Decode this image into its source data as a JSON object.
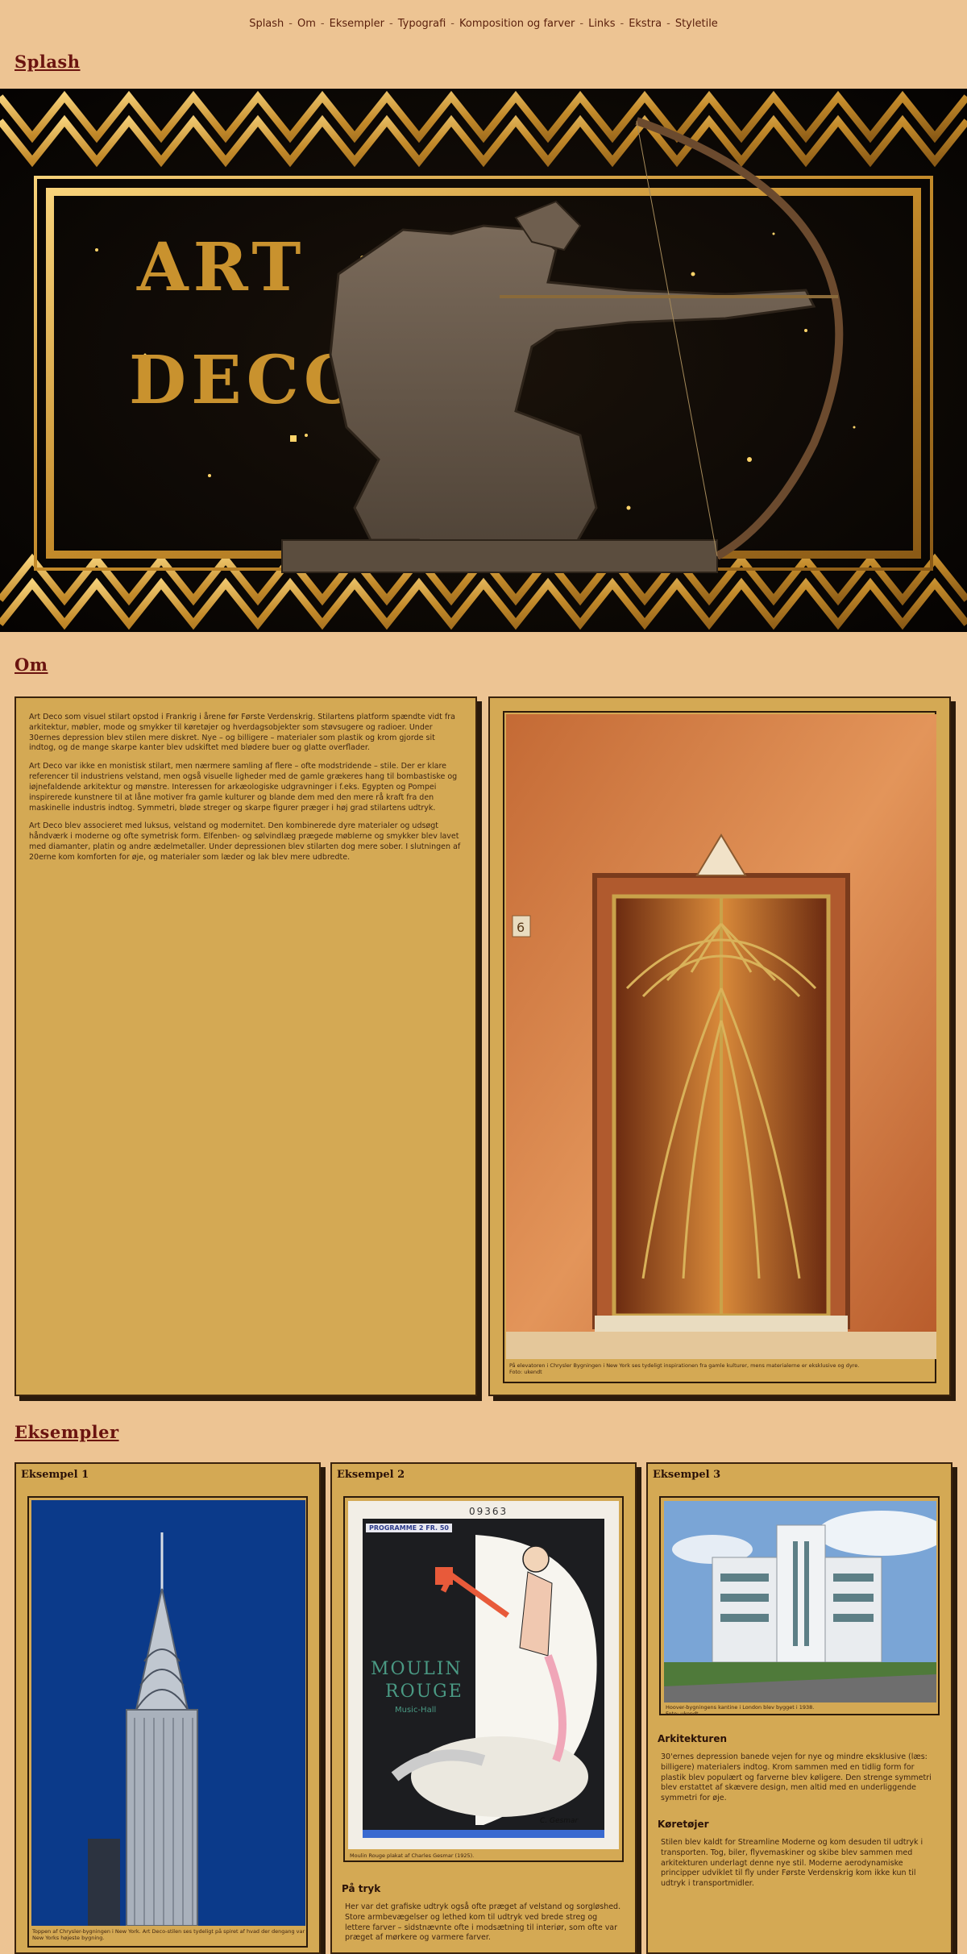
{
  "nav": {
    "items": [
      "Splash",
      "Om",
      "Eksempler",
      "Typografi",
      "Komposition og farver",
      "Links",
      "Ekstra",
      "Styletile"
    ],
    "separator": "-"
  },
  "sections": {
    "splash": "Splash",
    "om": "Om",
    "eksempler": "Eksempler"
  },
  "hero": {
    "line1": "ART",
    "line2": "DECO"
  },
  "om": {
    "paragraphs": [
      "Art Deco som visuel stilart opstod i Frankrig i årene før Første Verdenskrig. Stilartens platform spændte vidt fra arkitektur, møbler, mode og smykker til køretøjer og hverdagsobjekter som støvsugere og radioer. Under 30ernes depression blev stilen mere diskret. Nye – og billigere – materialer som plastik og krom gjorde sit indtog, og de mange skarpe kanter blev udskiftet med blødere buer og glatte overflader.",
      "Art Deco var ikke en monistisk stilart, men nærmere samling af flere – ofte modstridende – stile. Der er klare referencer til industriens velstand, men også visuelle ligheder med de gamle grækeres hang til bombastiske og iøjnefaldende arkitektur og mønstre. Interessen for arkæologiske udgravninger i f.eks. Egypten og Pompei inspirerede kunstnere til at låne motiver fra gamle kulturer og blande dem med den mere rå kraft fra den maskinelle industris indtog. Symmetri, bløde streger og skarpe figurer præger i høj grad stilartens udtryk.",
      "Art Deco blev associeret med luksus, velstand og modernitet. Den kombinerede dyre materialer og udsøgt håndværk i moderne og ofte symetrisk form. Elfenben- og sølvindlæg prægede møblerne og smykker blev lavet med diamanter, platin og andre ædelmetaller. Under depressionen blev stilarten dog mere sober. I slutningen af 20erne kom komforten for øje, og materialer som læder og lak blev mere udbredte."
    ],
    "image_caption": "På elevatoren i Chrysler Bygningen i New York ses tydeligt inspirationen fra gamle kulturer, mens materialerne er eksklusive og dyre.",
    "image_credit": "Foto: ukendt",
    "elevator_number": "6"
  },
  "examples": [
    {
      "title": "Eksempel 1",
      "caption": "Toppen af Chrysler-bygningen i New York. Art Deco-stilen ses tydeligt på spiret af hvad der dengang var New Yorks højeste bygning."
    },
    {
      "title": "Eksempel 2",
      "caption": "Moulin Rouge plakat af Charles Gesmar (1925).",
      "poster": {
        "number": "09363",
        "programme": "PROGRAMME 2 FR. 50",
        "title1": "MOULIN",
        "title2": "ROUGE",
        "subtitle": "Music-Hall",
        "signature": "C. Gesmar"
      },
      "heading": "På tryk",
      "text": "Her var det grafiske udtryk også ofte præget af velstand og sorgløshed. Store armbevægelser og lethed kom til udtryk ved brede streg og lettere farver – sidstnævnte ofte i modsætning til interiør, som ofte var præget af mørkere og varmere farver."
    },
    {
      "title": "Eksempel 3",
      "caption": "Hoover-bygningens kantine i London blev bygget i 1938.",
      "credit": "Foto: ukendt",
      "headings": [
        "Arkitekturen",
        "Køretøjer"
      ],
      "texts": [
        "30'ernes depression banede vejen for nye og mindre eksklusive (læs: billigere) materialers indtog. Krom sammen med en tidlig form for plastik blev populært og farverne blev køligere. Den strenge symmetri blev erstattet af skævere design, men altid med en underliggende symmetri for øje.",
        "Stilen blev kaldt for Streamline Moderne og kom desuden til udtryk i transporten. Tog, biler, flyvemaskiner og skibe blev sammen med arkitekturen underlagt denne nye stil. Moderne aerodynamiske principper udviklet til fly under Første Verdenskrig kom ikke kun til udtryk i transportmidler."
      ]
    }
  ],
  "colors": {
    "background": "#edc493",
    "panel": "#d4a954",
    "heading": "#6b1410",
    "gold": "#c9922e"
  }
}
